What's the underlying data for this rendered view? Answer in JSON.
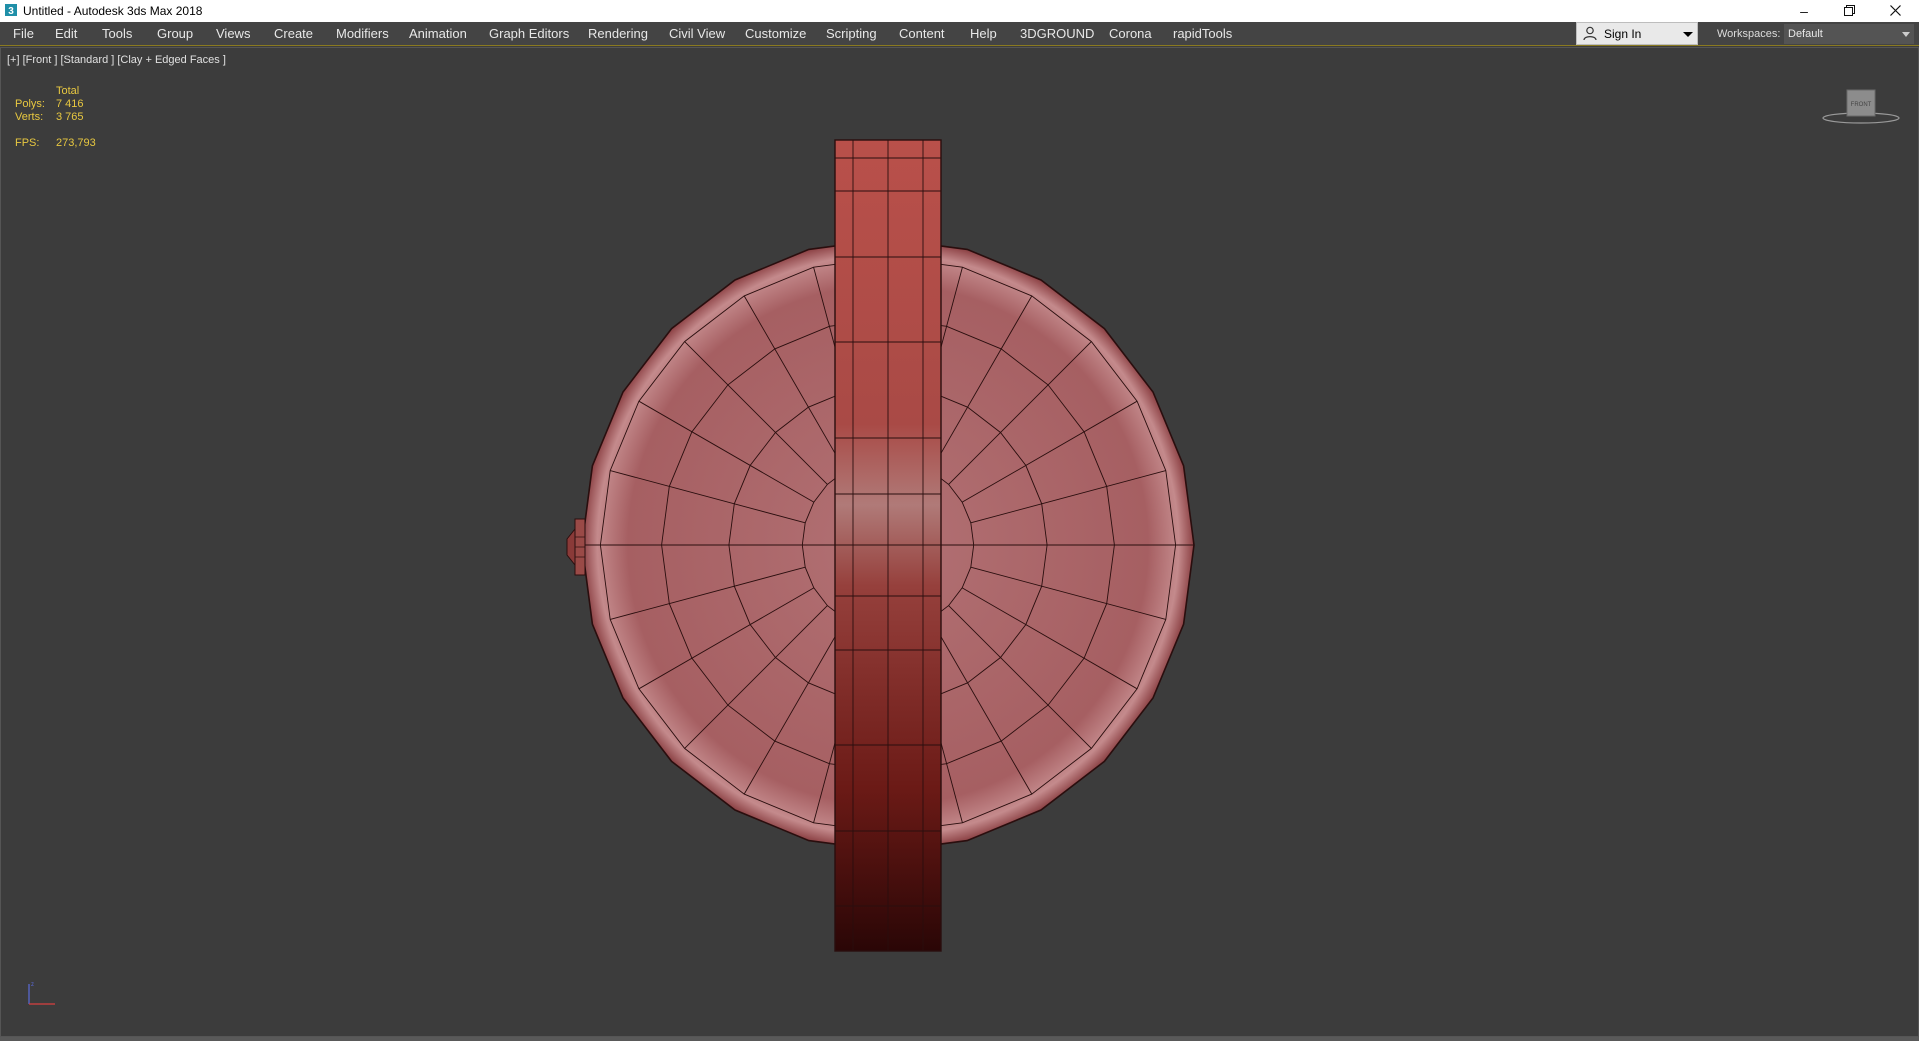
{
  "window": {
    "title": "Untitled - Autodesk 3ds Max 2018",
    "controls": [
      "minimize-icon",
      "restore-icon",
      "close-icon"
    ]
  },
  "menu": {
    "items": [
      "File",
      "Edit",
      "Tools",
      "Group",
      "Views",
      "Create",
      "Modifiers",
      "Animation",
      "Graph Editors",
      "Rendering",
      "Civil View",
      "Customize",
      "Scripting",
      "Content",
      "Help",
      "3DGROUND",
      "Corona",
      "rapidTools"
    ]
  },
  "account": {
    "sign_in_label": "Sign In"
  },
  "workspaces": {
    "label": "Workspaces:",
    "selected": "Default"
  },
  "viewport": {
    "label": "[+] [Front ] [Standard ] [Clay + Edged Faces ]",
    "stats": {
      "header": "Total",
      "polys_label": "Polys:",
      "polys_value": "7 416",
      "verts_label": "Verts:",
      "verts_value": "3 765",
      "fps_label": "FPS:",
      "fps_value": "273,793"
    },
    "viewcube_face": "FRONT"
  },
  "colors": {
    "viewport_bg": "#3c3c3c",
    "model_face": "#a85f63",
    "model_bar": "#b0463f",
    "wire": "#2a0e0e",
    "stats_text": "#e8c840"
  }
}
